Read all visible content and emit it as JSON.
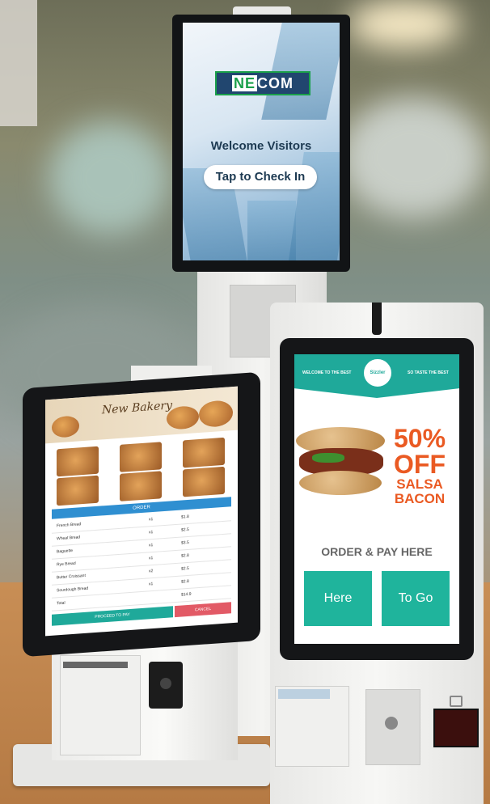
{
  "kiosk_top": {
    "logo": "NEXCOM",
    "logo_split": {
      "a": "NE",
      "b": "COM"
    },
    "welcome_text": "Welcome Visitors",
    "cta_button": "Tap to Check In"
  },
  "kiosk_left": {
    "brand_script": "New Bakery",
    "menu_header": "ORDER",
    "rows": [
      {
        "name": "French Bread",
        "qty": "x1",
        "price": "$1.8"
      },
      {
        "name": "Wheat Bread",
        "qty": "x1",
        "price": "$2.5"
      },
      {
        "name": "Baguette",
        "qty": "x1",
        "price": "$3.5"
      },
      {
        "name": "Rye Bread",
        "qty": "x1",
        "price": "$2.8"
      },
      {
        "name": "Butter Croissant",
        "qty": "x2",
        "price": "$2.5"
      },
      {
        "name": "Sourdough Bread",
        "qty": "x1",
        "price": "$2.8"
      },
      {
        "name": "Total",
        "qty": "",
        "price": "$14.9"
      }
    ],
    "pay_button": "PROCEED TO PAY",
    "cancel_button": "CANCEL"
  },
  "kiosk_right": {
    "header_left": "WELCOME TO THE BEST",
    "header_right": "SO TASTE THE BEST",
    "badge": "Sizzler",
    "offer_percent": "50%",
    "offer_word": "OFF",
    "offer_item1": "SALSA",
    "offer_item2": "BACON",
    "order_text": "ORDER & PAY HERE",
    "here_button": "Here",
    "togo_button": "To Go"
  },
  "colors": {
    "teal": "#1fb49c",
    "offer_orange": "#ea5a23",
    "nexcom_green": "#1aa04a",
    "nexcom_navy": "#21466f"
  }
}
